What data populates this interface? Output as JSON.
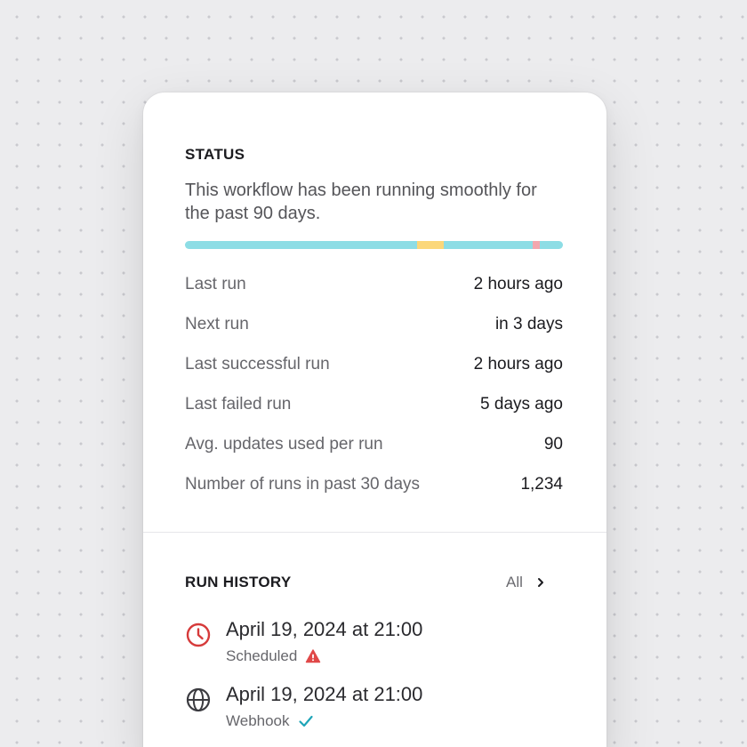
{
  "status": {
    "title": "STATUS",
    "description": "This workflow has been running smoothly for the past 90 days.",
    "bar_segments": [
      {
        "state": "success",
        "fraction": 0.615,
        "color": "#8ddde5"
      },
      {
        "state": "warning",
        "fraction": 0.07,
        "color": "#fbd77a"
      },
      {
        "state": "success",
        "fraction": 0.235,
        "color": "#8ddde5"
      },
      {
        "state": "failed",
        "fraction": 0.018,
        "color": "#f2a7ae"
      },
      {
        "state": "success",
        "fraction": 0.062,
        "color": "#8ddde5"
      }
    ],
    "rows": [
      {
        "label": "Last run",
        "value": "2 hours ago"
      },
      {
        "label": "Next run",
        "value": "in 3 days"
      },
      {
        "label": "Last successful run",
        "value": "2 hours ago"
      },
      {
        "label": "Last failed run",
        "value": "5 days ago"
      },
      {
        "label": "Avg. updates used per run",
        "value": "90"
      },
      {
        "label": "Number of runs in past 30 days",
        "value": "1,234"
      }
    ]
  },
  "run_history": {
    "title": "RUN HISTORY",
    "all_label": "All",
    "items": [
      {
        "date": "April 19, 2024 at 21:00",
        "type": "Scheduled",
        "icon": "clock-icon",
        "status_icon": "warning-icon",
        "status_color": "#e04848"
      },
      {
        "date": "April 19, 2024 at 21:00",
        "type": "Webhook",
        "icon": "globe-icon",
        "status_icon": "check-icon",
        "status_color": "#1fa5b8"
      }
    ]
  },
  "colors": {
    "clock_icon": "#d63b3b",
    "text_primary": "#1b1b1f",
    "text_secondary": "#66666b"
  }
}
